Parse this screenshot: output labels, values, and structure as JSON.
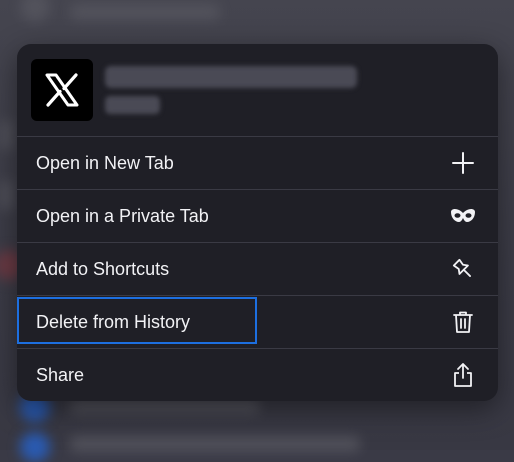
{
  "preview": {
    "logo_icon": "x-logo"
  },
  "menu": {
    "items": [
      {
        "label": "Open in New Tab",
        "icon": "plus-icon"
      },
      {
        "label": "Open in a Private Tab",
        "icon": "mask-icon"
      },
      {
        "label": "Add to Shortcuts",
        "icon": "pin-icon"
      },
      {
        "label": "Delete from History",
        "icon": "trash-icon"
      },
      {
        "label": "Share",
        "icon": "share-icon"
      }
    ]
  },
  "colors": {
    "menu_background": "#1f1f26",
    "focus_ring": "#1d6fe0",
    "text": "#f2f2f5"
  }
}
